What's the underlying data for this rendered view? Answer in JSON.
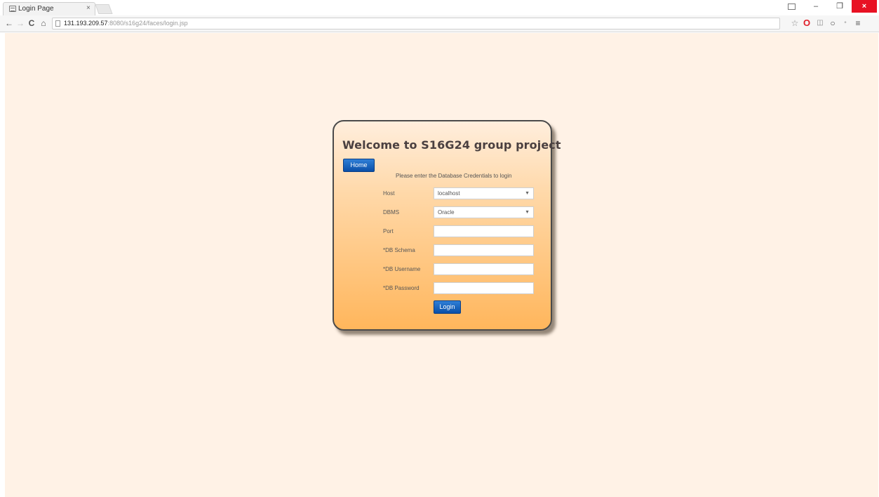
{
  "browser": {
    "tab_title": "Login Page",
    "tab_close": "×",
    "url_host": "131.193.209.57",
    "url_path": ":8080/s16g24/faces/login.jsp",
    "window": {
      "close_glyph": "×",
      "min_glyph": "–",
      "max_glyph": "❐"
    },
    "icons": [
      "back-icon",
      "forward-icon",
      "reload-icon",
      "home-icon",
      "star-icon",
      "opera-icon",
      "extension-icon",
      "menu-icon"
    ]
  },
  "page": {
    "title": "Welcome to S16G24 group project",
    "home_button": "Home",
    "instruction": "Please enter the Database Credentials to login",
    "fields": {
      "host": {
        "label": "Host",
        "value": "localhost"
      },
      "dbms": {
        "label": "DBMS",
        "value": "Oracle"
      },
      "port": {
        "label": "Port",
        "value": ""
      },
      "schema": {
        "label": "*DB Schema",
        "value": ""
      },
      "username": {
        "label": "*DB Username",
        "value": ""
      },
      "password": {
        "label": "*DB Password",
        "value": ""
      }
    },
    "login_button": "Login"
  },
  "colors": {
    "page_background": "#fff2e6",
    "card_gradient_top": "#ffeedd",
    "card_gradient_bottom": "#ffb65c",
    "button_blue": "#0a4fa8",
    "close_red": "#e81123"
  }
}
